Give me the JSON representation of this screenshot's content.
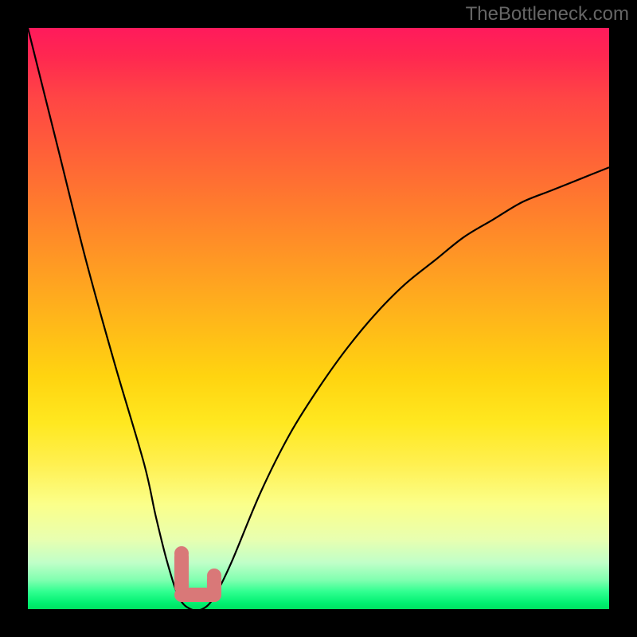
{
  "watermark": "TheBottleneck.com",
  "chart_data": {
    "type": "line",
    "title": "",
    "xlabel": "",
    "ylabel": "",
    "xlim": [
      0,
      100
    ],
    "ylim": [
      0,
      100
    ],
    "series": [
      {
        "name": "bottleneck-curve",
        "x": [
          0,
          5,
          10,
          15,
          20,
          22,
          24,
          26,
          28,
          30,
          32,
          35,
          40,
          45,
          50,
          55,
          60,
          65,
          70,
          75,
          80,
          85,
          90,
          95,
          100
        ],
        "y": [
          100,
          80,
          60,
          42,
          25,
          16,
          8,
          2,
          0,
          0,
          2,
          8,
          20,
          30,
          38,
          45,
          51,
          56,
          60,
          64,
          67,
          70,
          72,
          74,
          76
        ]
      }
    ],
    "marker": {
      "name": "optimal-range",
      "shape": "L",
      "x_range": [
        26,
        31
      ],
      "y_range": [
        0,
        7
      ],
      "color": "#d97878"
    },
    "background_gradient": {
      "top": "#ff1a5c",
      "mid": "#ffd410",
      "bottom": "#00e060"
    }
  }
}
